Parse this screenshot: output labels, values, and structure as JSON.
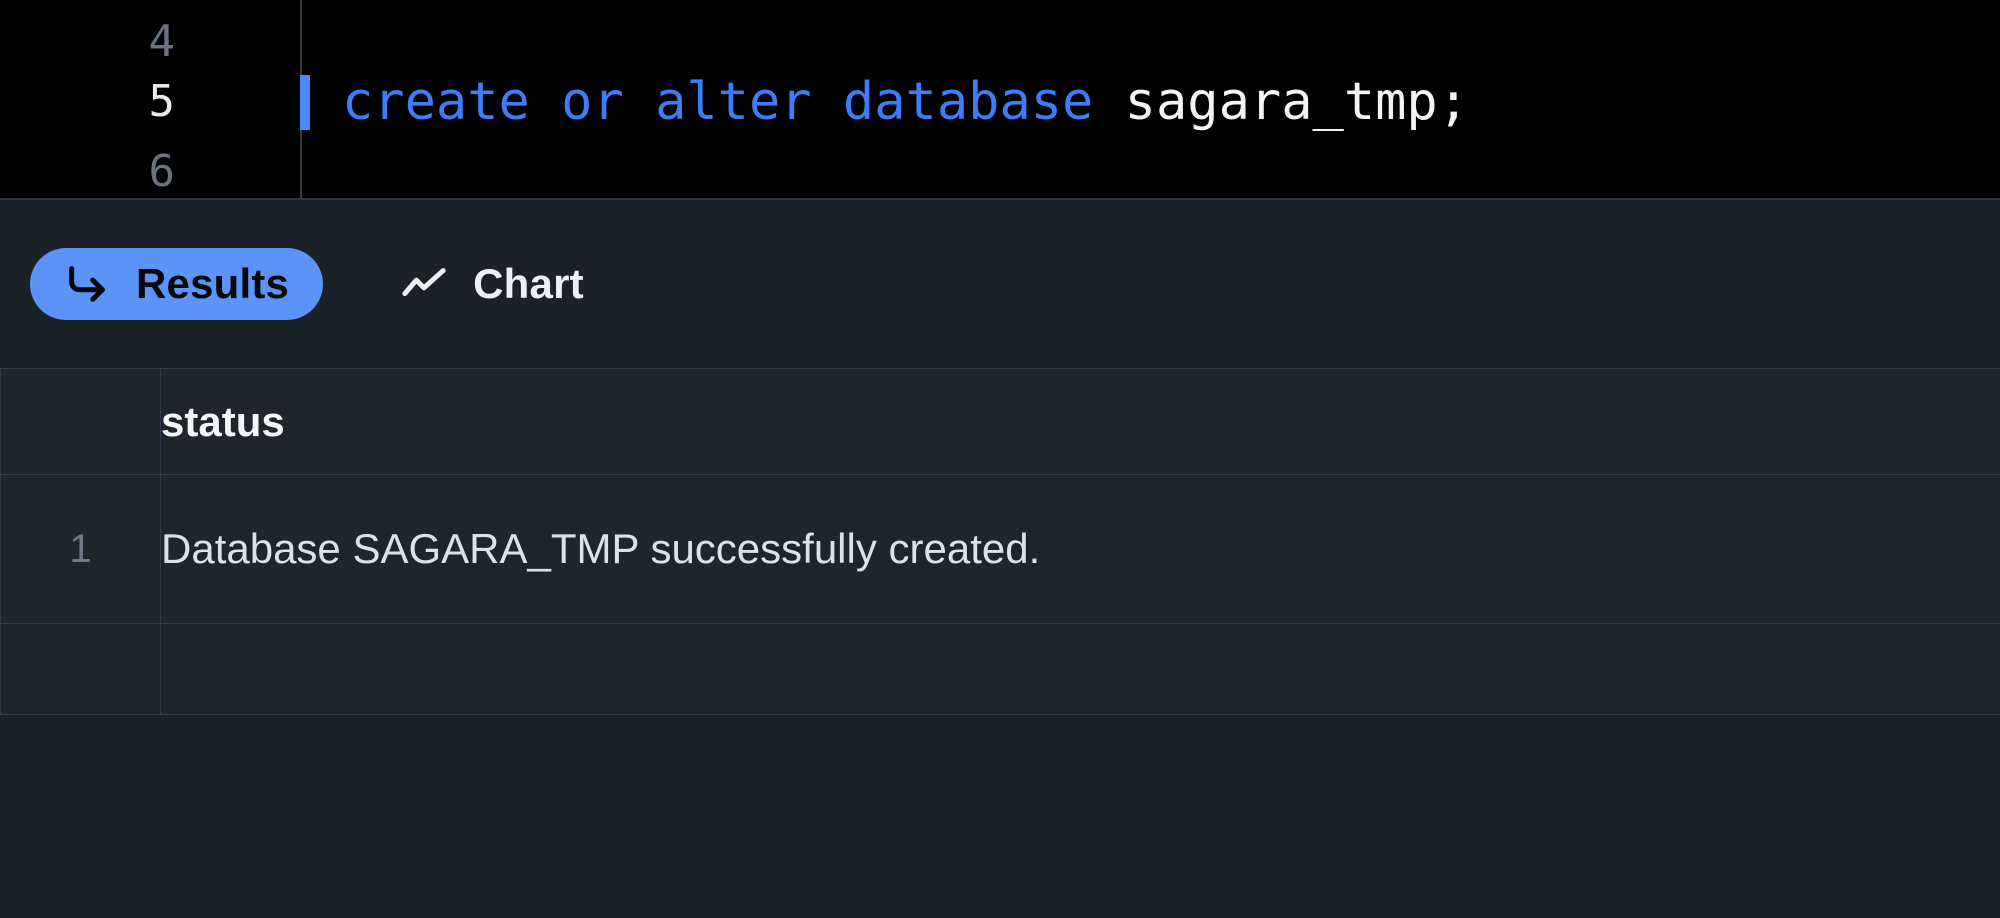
{
  "editor": {
    "background_color": "#000000",
    "line_numbers": [
      "4",
      "5",
      "6"
    ],
    "active_line_number": "5",
    "cursor_color": "#4a8af4",
    "keyword_color": "#3d7df7",
    "identifier_color": "#f2f4f8",
    "code": {
      "keyword_create_or_alter_database": "create or alter database",
      "identifier": "sagara_tmp",
      "terminator": ";",
      "full_line": "create or alter database sagara_tmp;"
    }
  },
  "tabs": {
    "active": "Results",
    "items": [
      {
        "label": "Results",
        "icon": "corner-down-right-arrow-icon",
        "active": true,
        "background_color": "#5b93f7",
        "text_color": "#08080a"
      },
      {
        "label": "Chart",
        "icon": "line-chart-icon",
        "active": false,
        "background_color": "transparent",
        "text_color": "#eceff4"
      }
    ]
  },
  "results_table": {
    "row_index_header": "",
    "columns": [
      "status"
    ],
    "rows": [
      {
        "index": "1",
        "status": "Database SAGARA_TMP successfully created."
      }
    ],
    "has_trailing_empty_row": true,
    "border_color": "#333c4d",
    "surface_color": "#1f242d"
  }
}
